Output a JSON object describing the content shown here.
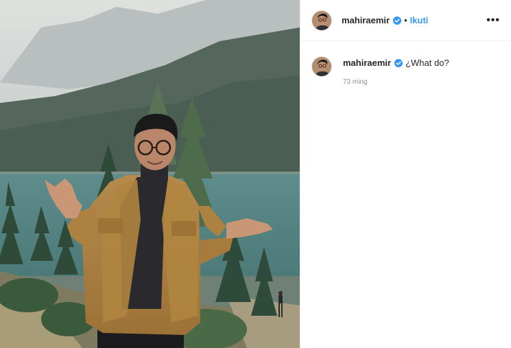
{
  "post": {
    "author": {
      "username": "mahiraemir",
      "verified": true,
      "avatar_icon": "profile-photo"
    },
    "header": {
      "separator": "•",
      "follow_label": "Ikuti",
      "more_icon": "more-options-icon",
      "more_label": "•••"
    },
    "caption": {
      "username": "mahiraemir",
      "text": "¿What do?",
      "timestamp": "73 ming"
    },
    "photo": {
      "description_icon": "post-photo"
    }
  },
  "colors": {
    "link": "#3897f0",
    "verified_badge": "#3897f0",
    "muted_text": "#8e8e8e",
    "divider": "#efefef"
  }
}
